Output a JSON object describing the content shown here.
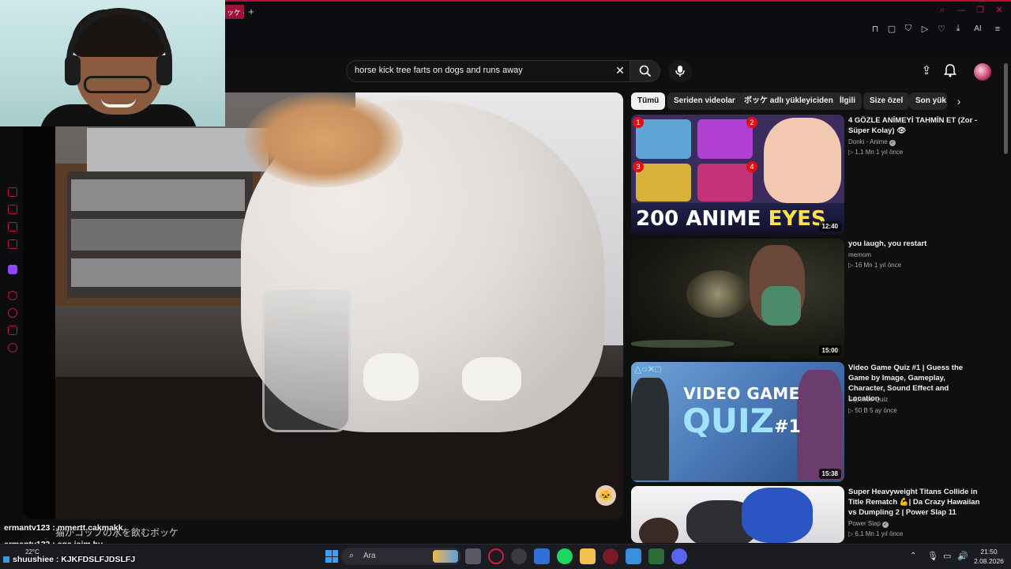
{
  "browser": {
    "tab_label": "ッケ -",
    "add_tab": "+",
    "ai_label": "AI"
  },
  "search": {
    "query": "horse kick tree farts on dogs and runs away",
    "clear": "✕"
  },
  "chips": [
    "Tümü",
    "Seriden videolar",
    "ボッケ adlı yükleyiciden",
    "İlgili",
    "Size özel",
    "Son yük"
  ],
  "recommendations": [
    {
      "title": "4 GÖZLE ANİMEYİ TAHMİN ET (Zor - Süper Kolay) 👁",
      "channel": "Donki - Anime",
      "meta": "▷ 1,1 Mn   1 yıl önce",
      "duration": "12:40",
      "thumb_text_a": "200 ANIME ",
      "thumb_text_b": "EYES",
      "badges": [
        "1",
        "2",
        "3",
        "4"
      ]
    },
    {
      "title": "you laugh, you restart",
      "channel": "memom",
      "meta": "▷ 16 Mn   1 yıl önce",
      "duration": "15:00"
    },
    {
      "title": "Video Game Quiz #1 | Guess the Game by Image, Gameplay, Character, Sound Effect and Location",
      "channel": "Squeeze Quiz",
      "meta": "▷ 50 B   5 ay önce",
      "duration": "15:38",
      "thumb_text_a": "VIDEO GAME",
      "thumb_text_b": "QUIZ",
      "thumb_text_c": "#1"
    },
    {
      "title": "Super Heavyweight Titans Collide in Title Rematch 💪| Da Crazy Hawaiian vs Dumpling 2 | Power Slap 11",
      "channel": "Power Slap",
      "meta": "▷ 6,1 Mn   1 yıl önce"
    }
  ],
  "chat": [
    {
      "text": "ermantv123 : mmertt.cakmakk"
    },
    {
      "text": "ermantv123 : aga isim bu"
    },
    {
      "text": "shuushiee : KJKFDSLFJDSLFJ"
    }
  ],
  "subtitle": "猫がコップの水を飲むボッケ",
  "taskbar": {
    "search_placeholder": "Ara",
    "weather": "22°C",
    "time": "21:50",
    "date": "2.08.2026"
  },
  "colors": {
    "accent": "#c0183f",
    "yt_bg": "#0f0f0f",
    "chip_bg": "#272727"
  },
  "icons": [
    "search-icon",
    "mic-icon",
    "bell-icon",
    "upload-icon",
    "chevron-right-icon",
    "windows-start-icon"
  ]
}
